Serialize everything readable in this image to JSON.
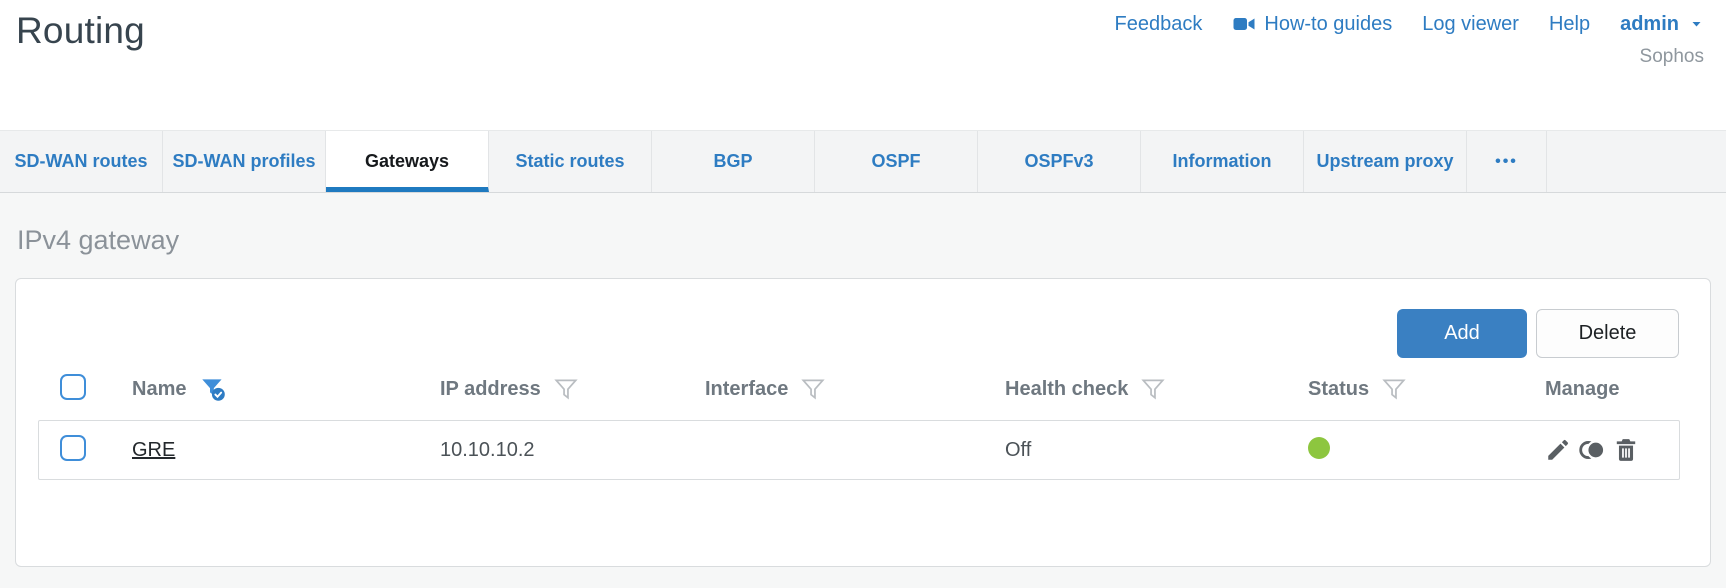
{
  "header": {
    "title": "Routing",
    "links": {
      "feedback": "Feedback",
      "howto": "How-to guides",
      "logviewer": "Log viewer",
      "help": "Help",
      "user": "admin"
    },
    "brand": "Sophos"
  },
  "tabs": {
    "items": [
      {
        "label": "SD-WAN routes",
        "active": false
      },
      {
        "label": "SD-WAN profiles",
        "active": false
      },
      {
        "label": "Gateways",
        "active": true
      },
      {
        "label": "Static routes",
        "active": false
      },
      {
        "label": "BGP",
        "active": false
      },
      {
        "label": "OSPF",
        "active": false
      },
      {
        "label": "OSPFv3",
        "active": false
      },
      {
        "label": "Information",
        "active": false
      },
      {
        "label": "Upstream proxy",
        "active": false
      },
      {
        "label": "•••",
        "active": false
      }
    ]
  },
  "main": {
    "section_title": "IPv4 gateway",
    "toolbar": {
      "add_label": "Add",
      "delete_label": "Delete"
    },
    "table": {
      "columns": [
        {
          "label": "Name",
          "filter": "active"
        },
        {
          "label": "IP address",
          "filter": "inactive"
        },
        {
          "label": "Interface",
          "filter": "inactive"
        },
        {
          "label": "Health check",
          "filter": "inactive"
        },
        {
          "label": "Status",
          "filter": "inactive"
        },
        {
          "label": "Manage",
          "filter": "none"
        }
      ],
      "rows": [
        {
          "name": "GRE",
          "ip_address": "10.10.10.2",
          "interface": "",
          "health_check": "Off",
          "status": "up",
          "status_color": "#8dc63f"
        }
      ]
    }
  },
  "colors": {
    "accent_blue": "#2e7cc2",
    "active_tab_underline": "#1f7ac0",
    "status_green": "#8dc63f"
  }
}
